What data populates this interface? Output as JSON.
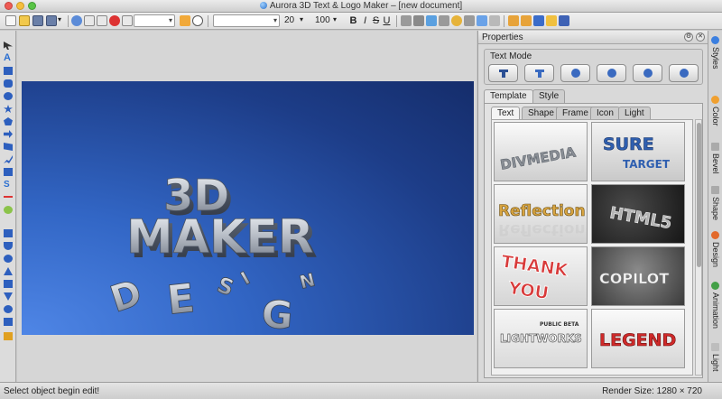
{
  "window": {
    "title": "Aurora 3D Text & Logo Maker – [new document]"
  },
  "toolbar": {
    "font_size": "20",
    "zoom": "100",
    "bold_label": "B",
    "italic_label": "I",
    "strike_label": "S",
    "underline_label": "U"
  },
  "properties": {
    "title": "Properties",
    "text_mode_title": "Text Mode",
    "tabs": [
      "Template",
      "Style"
    ],
    "subtabs": [
      "Text",
      "Shape",
      "Frame",
      "Icon",
      "Light"
    ],
    "templates": [
      {
        "name": "DIVMEDIA"
      },
      {
        "name": "SURE TARGET",
        "line1": "SURE",
        "line2": "TARGET"
      },
      {
        "name": "Reflection"
      },
      {
        "name": "HTML5"
      },
      {
        "name": "THANK YOU",
        "line1": "THANK",
        "line2": "YOU"
      },
      {
        "name": "COPILOT"
      },
      {
        "name": "LIGHTWORKS",
        "badge": "PUBLIC BETA"
      },
      {
        "name": "LEGEND"
      }
    ]
  },
  "canvas": {
    "line1": "3D",
    "line2": "MAKER",
    "design_letters": [
      "D",
      "E",
      "S",
      "I",
      "G",
      "N"
    ]
  },
  "right_tabs": [
    "Styles",
    "Color",
    "Bevel",
    "Shape",
    "Design",
    "Animation",
    "Light"
  ],
  "status": {
    "message": "Select object begin edit!",
    "render_size": "Render Size: 1280 × 720"
  },
  "colors": {
    "stage_bg": "#2a56b3",
    "accent_blue": "#2f7de0"
  }
}
